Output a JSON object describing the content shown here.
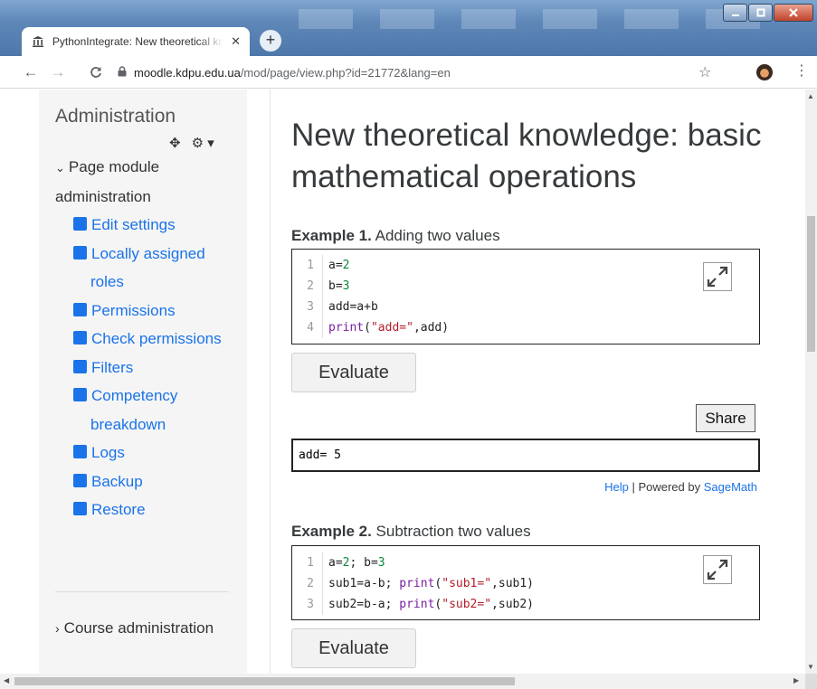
{
  "browser": {
    "tab_title": "PythonIntegrate: New theoretical knowledge: basic mathematical operations",
    "url_host": "moodle.kdpu.edu.ua",
    "url_path": "/mod/page/view.php?id=21772&lang=en"
  },
  "sidebar": {
    "title": "Administration",
    "section": "Page module administration",
    "items": [
      {
        "label": "Edit settings"
      },
      {
        "label": "Locally assigned roles"
      },
      {
        "label": "Permissions"
      },
      {
        "label": "Check permissions"
      },
      {
        "label": "Filters"
      },
      {
        "label": "Competency breakdown"
      },
      {
        "label": "Logs"
      },
      {
        "label": "Backup"
      },
      {
        "label": "Restore"
      }
    ],
    "course_admin": "Course administration"
  },
  "page": {
    "title": "New theoretical knowledge: basic mathematical operations",
    "example1": {
      "heading_bold": "Example 1.",
      "heading_rest": " Adding two values",
      "evaluate_label": "Evaluate",
      "share_label": "Share",
      "output": "add= 5",
      "help": "Help",
      "powered_by": " | Powered by ",
      "sagemath": "SageMath"
    },
    "example2": {
      "heading_bold": "Example 2.",
      "heading_rest": " Subtraction two values",
      "evaluate_label": "Evaluate"
    }
  },
  "colors": {
    "link": "#1a73e8",
    "accent_square": "#1a73e8"
  }
}
